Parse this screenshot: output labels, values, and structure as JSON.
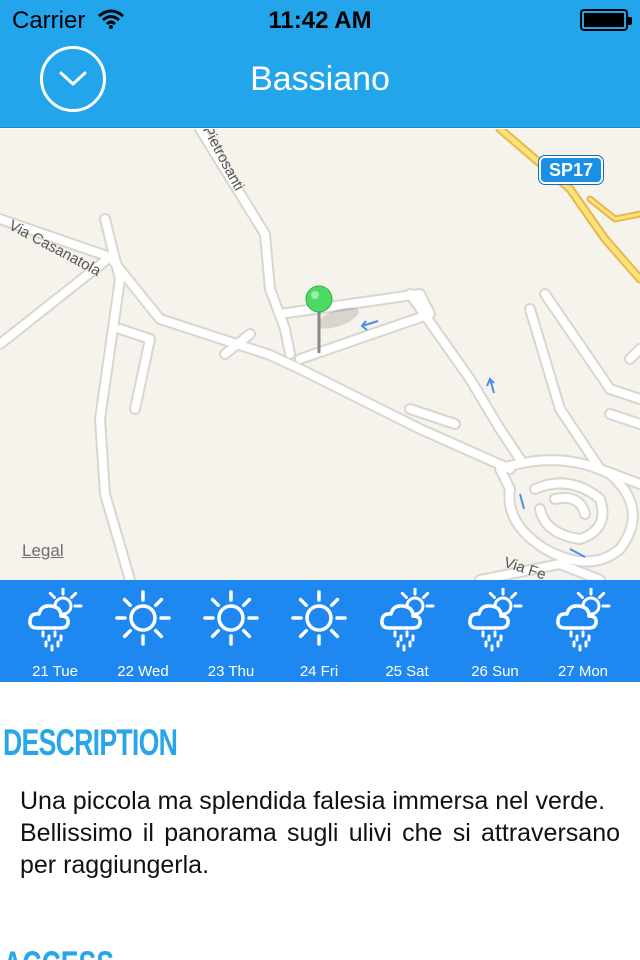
{
  "status_bar": {
    "carrier": "Carrier",
    "time": "11:42 AM"
  },
  "nav": {
    "title": "Bassiano",
    "collapse_icon": "chevron-down-icon"
  },
  "map": {
    "legal": "Legal",
    "road_labels": [
      "Via Casanatola",
      "Pietrosanti",
      "Via Fe"
    ],
    "highway_badge": "SP17",
    "pin_color": "#4cd964"
  },
  "forecast": [
    {
      "label": "21 Tue",
      "icon": "rain-cloud-sun-icon"
    },
    {
      "label": "22 Wed",
      "icon": "sun-icon"
    },
    {
      "label": "23 Thu",
      "icon": "sun-icon"
    },
    {
      "label": "24 Fri",
      "icon": "sun-icon"
    },
    {
      "label": "25 Sat",
      "icon": "rain-cloud-sun-icon"
    },
    {
      "label": "26 Sun",
      "icon": "rain-cloud-sun-icon"
    },
    {
      "label": "27 Mon",
      "icon": "rain-cloud-sun-icon"
    }
  ],
  "description": {
    "heading": "DESCRIPTION",
    "line1": "Una piccola ma splendida falesia immersa nel verde.",
    "line2": "Bellissimo il panorama sugli ulivi che si attraversano per raggiungerla."
  },
  "access": {
    "heading": "ACCESS"
  },
  "colors": {
    "header": "#23a5eb",
    "forecast_bar": "#1e88f0",
    "heading": "#29a6ea"
  }
}
